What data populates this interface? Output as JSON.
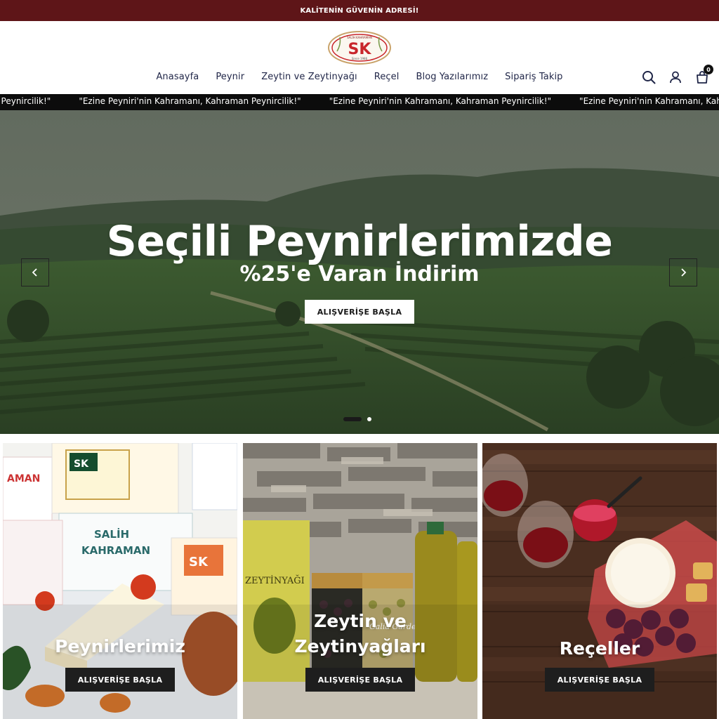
{
  "announcement": "KALİTENİN GÜVENİN ADRESİ!",
  "logo": {
    "letters": "SK",
    "top_text": "SALİH KAHRAMAN",
    "since": "Since 1986"
  },
  "nav": [
    {
      "label": "Anasayfa"
    },
    {
      "label": "Peynir"
    },
    {
      "label": "Zeytin ve Zeytinyağı"
    },
    {
      "label": "Reçel"
    },
    {
      "label": "Blog Yazılarımız"
    },
    {
      "label": "Sipariş Takip"
    }
  ],
  "header_icons": [
    "search-icon",
    "user-icon",
    "cart-icon"
  ],
  "cart_count": "0",
  "marquee": {
    "first_fragment": "\"Ezine Peynircilik!\"",
    "items": [
      "\"Ezine Peyniri'nin Kahramanı, Kahraman Peynircilik!\"",
      "\"Ezine Peyniri'nin Kahramanı, Kahraman Peynircilik!\"",
      "\"Ezine Peyniri'nin Kahramanı, Kahraman Peynircilik!\""
    ]
  },
  "hero": {
    "title": "Seçili Peynirlerimizde",
    "subtitle": "%25'e Varan İndirim",
    "button": "ALIŞVERİŞE BAŞLA",
    "slide_index": 1,
    "slide_count": 2
  },
  "categories": [
    {
      "title": "Peynirlerimiz",
      "button": "ALIŞVERİŞE BAŞLA"
    },
    {
      "title": "Zeytin ve\nZeytinyağları",
      "button": "ALIŞVERİŞE BAŞLA",
      "jar_label": "Galia Garden",
      "tin_label": "ZEYTİNYAĞI"
    },
    {
      "title": "Reçeller",
      "button": "ALIŞVERİŞE BAŞLA"
    }
  ],
  "colors": {
    "announce_bg": "#5e1518",
    "marquee_bg": "#0c0c0c",
    "nav_text": "#1f2547",
    "button_dark": "#1e1e1e",
    "logo_red": "#c8262b"
  }
}
